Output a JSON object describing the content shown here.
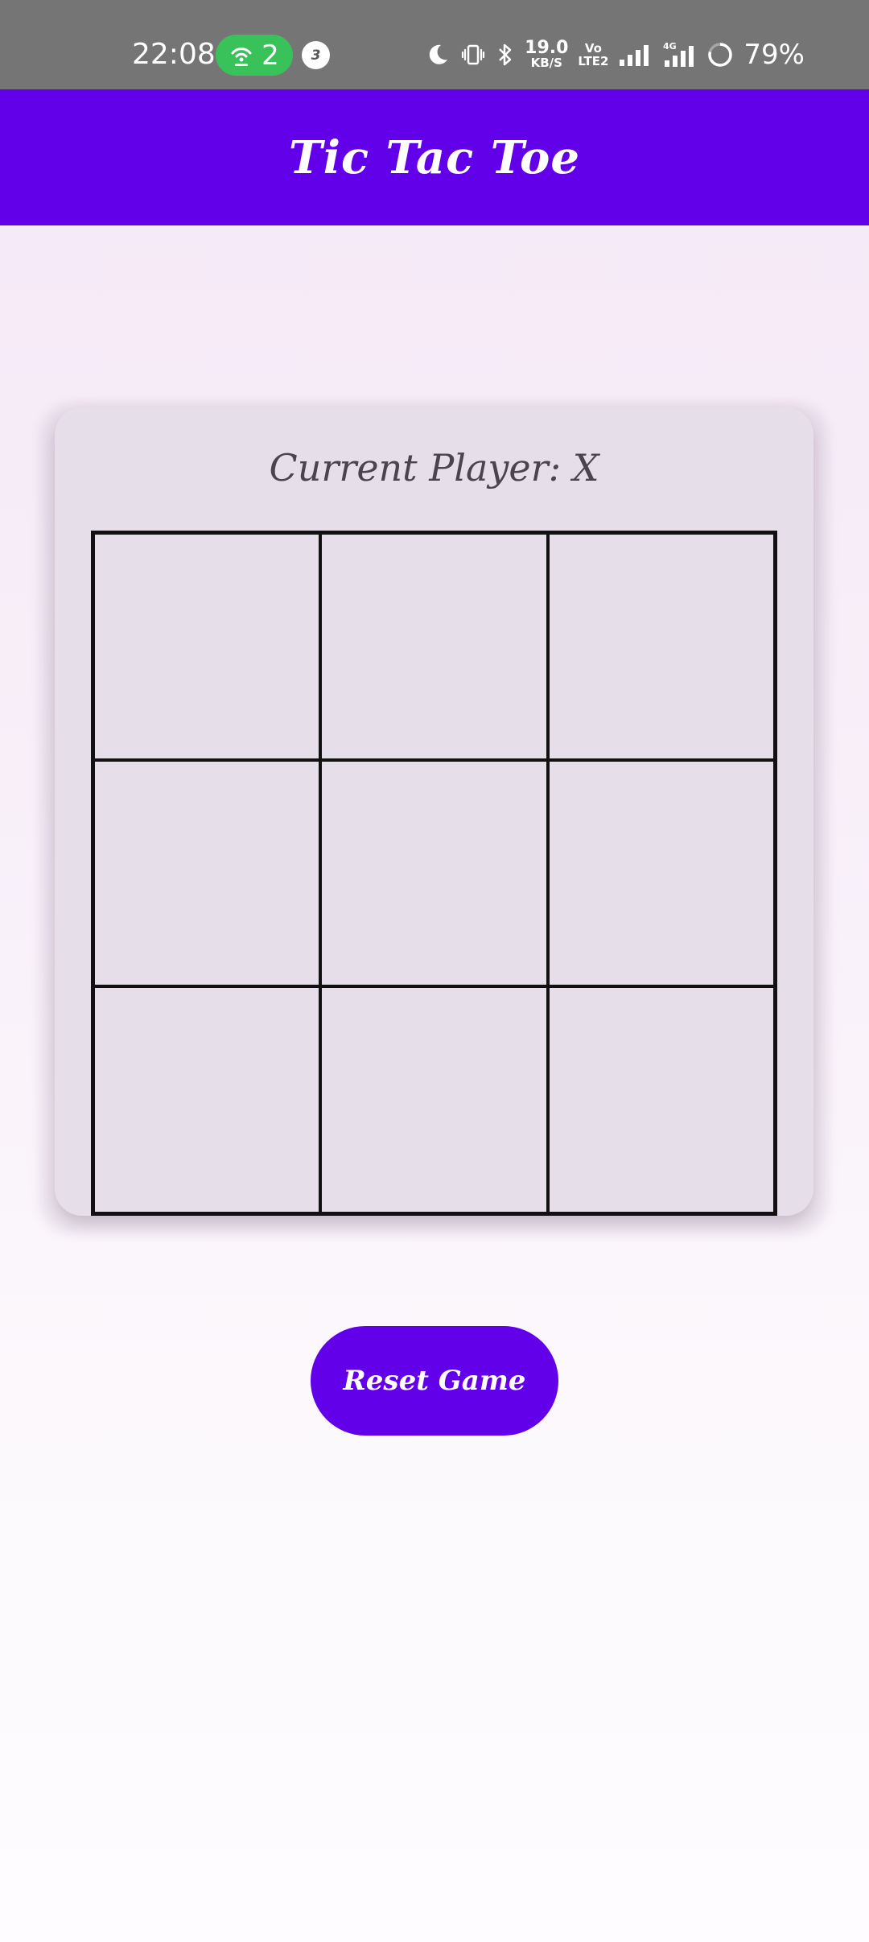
{
  "status_bar": {
    "time": "22:08",
    "hotspot_count": "2",
    "notification_count": "3",
    "net_speed": "19.0",
    "net_speed_unit": "KB/S",
    "volte_top": "Vo",
    "volte_bottom": "LTE2",
    "network_type": "4G",
    "battery_percent": "79%",
    "hotspot_color": "#3ac25a",
    "background": "#757575"
  },
  "app_bar": {
    "title": "Tic Tac Toe",
    "color": "#6200ea"
  },
  "game": {
    "status_text": "Current Player: X",
    "board": [
      "",
      "",
      "",
      "",
      "",
      "",
      "",
      "",
      ""
    ]
  },
  "actions": {
    "reset_label": "Reset Game"
  }
}
